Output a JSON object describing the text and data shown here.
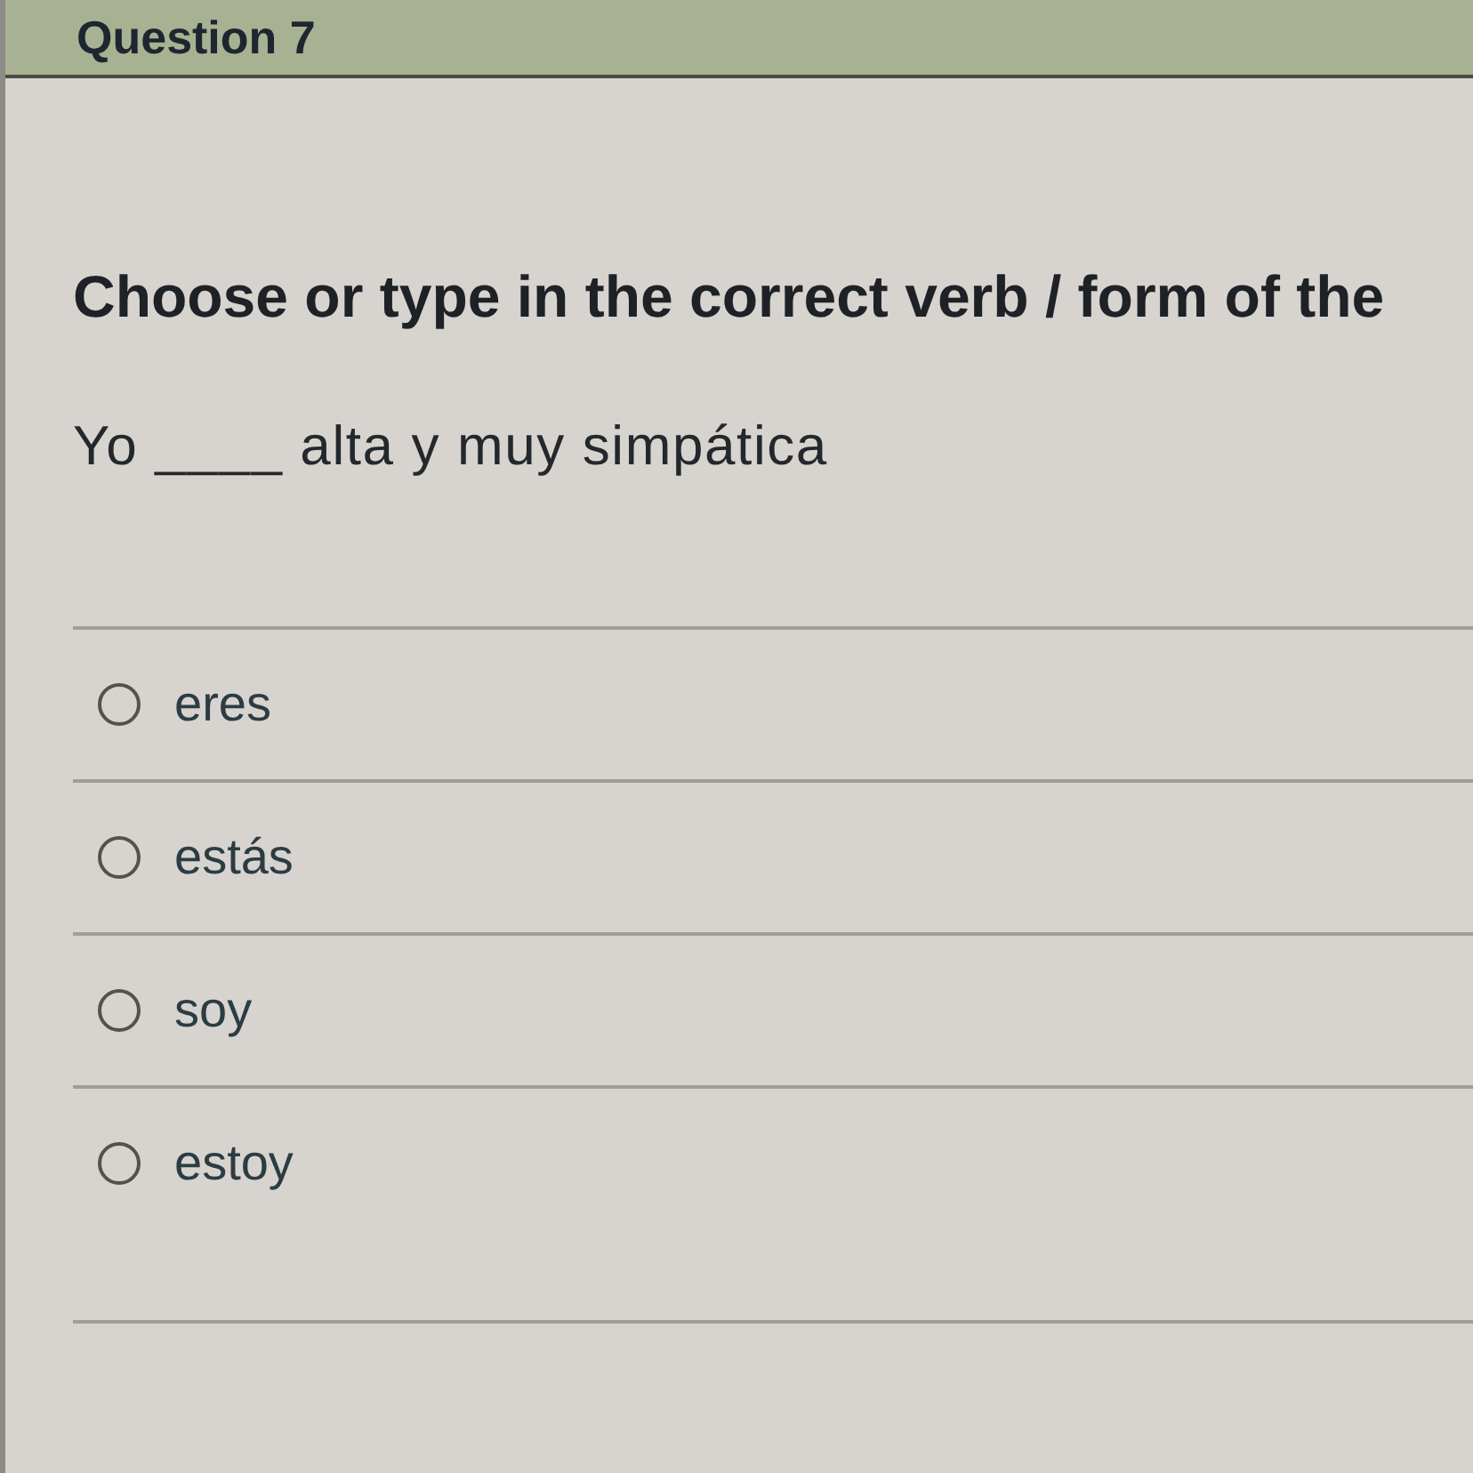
{
  "header": {
    "title": "Question 7"
  },
  "instructions": "Choose or type in the correct verb / form of the",
  "prompt": "Yo ____ alta y muy simpática",
  "options": [
    {
      "label": "eres",
      "selected": false
    },
    {
      "label": "estás",
      "selected": false
    },
    {
      "label": "soy",
      "selected": false
    },
    {
      "label": "estoy",
      "selected": false
    }
  ]
}
